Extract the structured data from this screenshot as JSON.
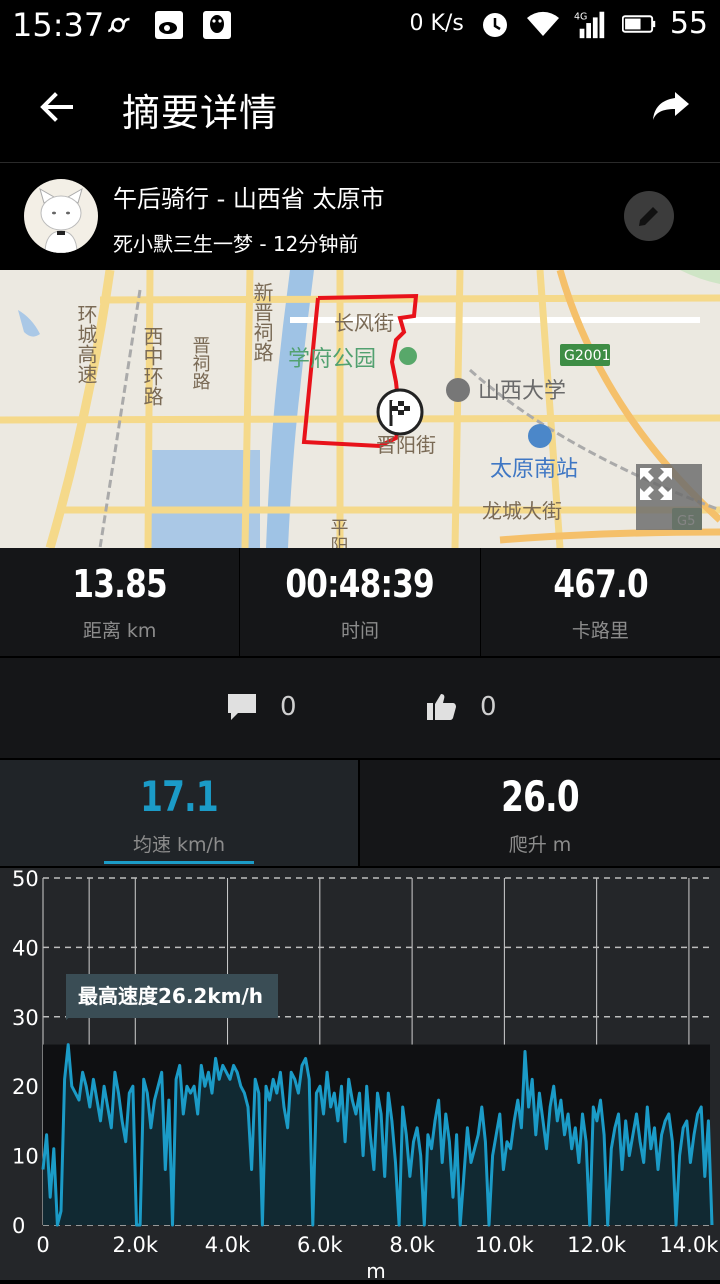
{
  "status_bar": {
    "time": "15:37",
    "net_speed": "0 K/s",
    "battery": "55"
  },
  "header": {
    "title": "摘要详情"
  },
  "activity": {
    "title": "午后骑行 - 山西省 太原市",
    "subtitle": "死小默三生一梦 - 12分钟前"
  },
  "map": {
    "labels": [
      "西中环路",
      "新晋祠路",
      "晋祠路",
      "环城高速",
      "长风街",
      "学府公园",
      "山西大学",
      "晋阳街",
      "太原南站",
      "龙城大街",
      "平阳",
      "G2001",
      "G5"
    ]
  },
  "stats": [
    {
      "value": "13.85",
      "label": "距离  km"
    },
    {
      "value": "00:48:39",
      "label": "时间"
    },
    {
      "value": "467.0",
      "label": "卡路里"
    }
  ],
  "social": {
    "comments": "0",
    "likes": "0"
  },
  "tabs": [
    {
      "value": "17.1",
      "label": "均速 km/h"
    },
    {
      "value": "26.0",
      "label": "爬升 m"
    }
  ],
  "colors": {
    "accent": "#1b9bc7",
    "route": "#e8121a",
    "panel": "#151618"
  },
  "chart_data": {
    "type": "area",
    "xlabel": "m",
    "xlim": [
      0,
      14500
    ],
    "ylim": [
      0,
      50
    ],
    "x_ticks": [
      "0",
      "2.0k",
      "4.0k",
      "6.0k",
      "8.0k",
      "10.0k",
      "12.0k",
      "14.0k"
    ],
    "y_ticks": [
      "0",
      "10",
      "20",
      "30",
      "40",
      "50"
    ],
    "annotation": "最高速度26.2km/h",
    "series": [
      {
        "values": [
          8,
          13,
          4,
          11,
          0,
          2,
          21,
          26,
          20,
          19,
          18,
          22,
          20,
          17,
          21,
          18,
          15,
          20,
          17,
          14,
          22,
          19,
          15,
          12,
          19,
          20,
          0,
          0,
          21,
          19,
          14,
          18,
          20,
          22,
          8,
          18,
          0,
          21,
          23,
          16,
          20,
          19,
          20,
          16,
          23,
          20,
          22,
          19,
          24,
          21,
          23,
          22,
          21,
          23,
          22,
          20,
          19,
          17,
          8,
          21,
          19,
          0,
          20,
          18,
          21,
          19,
          22,
          17,
          14,
          22,
          21,
          19,
          23,
          24,
          21,
          0,
          19,
          20,
          16,
          22,
          17,
          19,
          15,
          20,
          12,
          21,
          18,
          16,
          19,
          10,
          20,
          13,
          8,
          19,
          16,
          7,
          19,
          15,
          9,
          0,
          17,
          13,
          7,
          12,
          14,
          10,
          0,
          13,
          11,
          15,
          18,
          9,
          16,
          12,
          4,
          13,
          0,
          7,
          14,
          9,
          11,
          13,
          17,
          12,
          0,
          10,
          13,
          16,
          8,
          12,
          11,
          15,
          18,
          14,
          25,
          17,
          21,
          13,
          19,
          15,
          11,
          17,
          20,
          15,
          18,
          13,
          16,
          11,
          14,
          9,
          16,
          12,
          0,
          17,
          15,
          18,
          13,
          0,
          11,
          14,
          16,
          8,
          15,
          10,
          13,
          16,
          12,
          9,
          17,
          11,
          14,
          8,
          13,
          15,
          16,
          12,
          0,
          10,
          14,
          15,
          9,
          13,
          16,
          17,
          7,
          15,
          0
        ]
      }
    ]
  }
}
